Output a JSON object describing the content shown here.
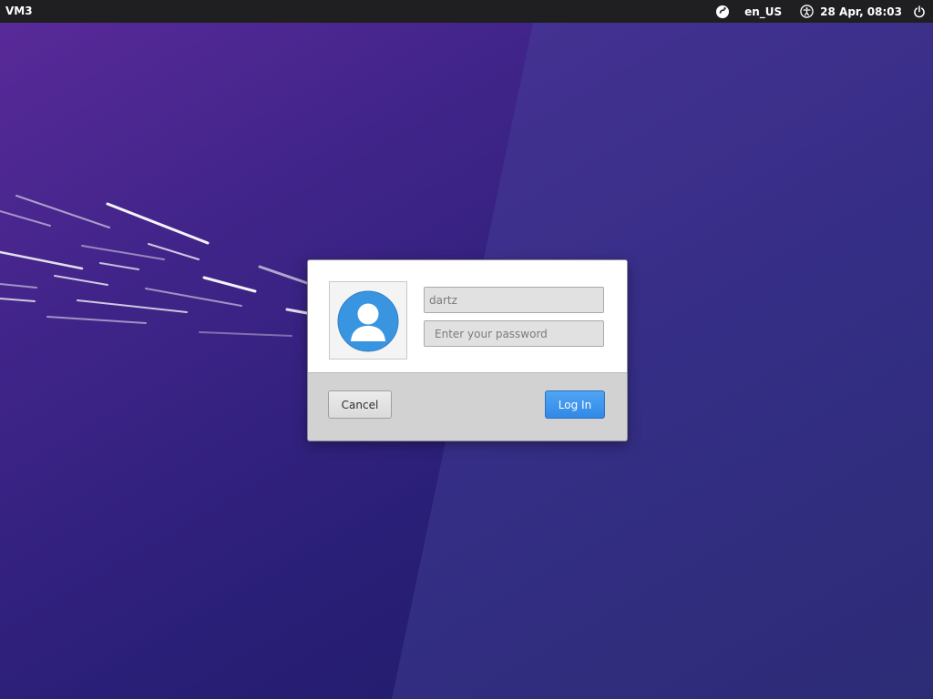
{
  "panel": {
    "host": "VM3",
    "keyboard_layout": "en_US",
    "clock": "28 Apr, 08:03",
    "icons": {
      "session": "session-icon",
      "accessibility": "accessibility-icon",
      "power": "power-icon"
    }
  },
  "login": {
    "username": "dartz",
    "password_placeholder": "Enter your password",
    "cancel_label": "Cancel",
    "login_label": "Log In",
    "avatar_icon": "user-avatar-icon"
  },
  "colors": {
    "panel_background": "#1f1f22",
    "desktop_top": "#5a2a9a",
    "desktop_bottom": "#1c1d60",
    "accent": "#3d93ec",
    "avatar_blue": "#3a95e0"
  }
}
